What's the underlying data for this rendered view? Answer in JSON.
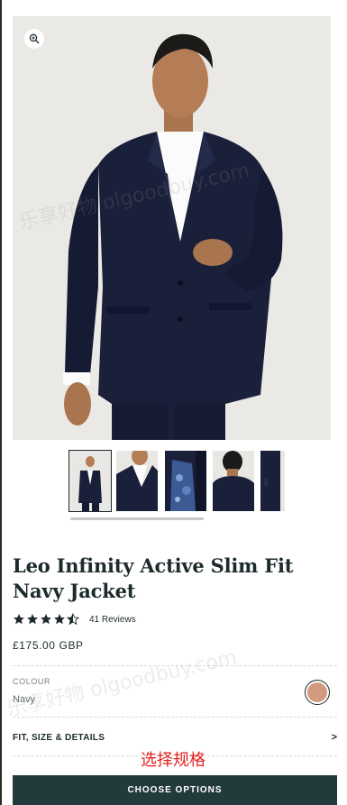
{
  "product": {
    "title": "Leo Infinity Active Slim Fit Navy Jacket",
    "rating": 4.5,
    "reviews_label": "41 Reviews",
    "price": "£175.00 GBP"
  },
  "colour": {
    "label": "COLOUR",
    "value": "Navy",
    "swatch_color": "#d39a7f"
  },
  "details": {
    "label": "FIT, SIZE & DETAILS",
    "chevron": ">"
  },
  "annotation": {
    "text": "选择规格"
  },
  "cta": {
    "label": "CHOOSE OPTIONS"
  },
  "watermark": {
    "line1": "乐享好物 olgoodbuy.com",
    "line2": "乐享好物 olgoodbuy.com"
  },
  "icons": {
    "zoom": "zoom-in-icon",
    "star": "star-icon"
  },
  "colors": {
    "brand_dark": "#233a3d",
    "text": "#1d2a2c",
    "annotation": "#e62020",
    "suit_navy": "#1a1f3a"
  },
  "gallery": {
    "thumbnails": [
      "front-full",
      "closeup-front",
      "lining-detail",
      "back-detail",
      "side-partial"
    ],
    "active_index": 0
  }
}
